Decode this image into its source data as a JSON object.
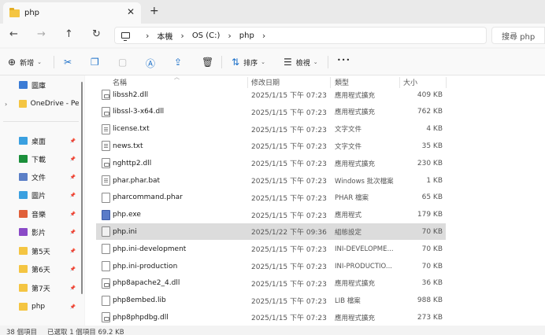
{
  "tab": {
    "title": "php",
    "close": "✕",
    "new_tab": "+"
  },
  "nav": {
    "back": "←",
    "forward": "→",
    "up": "↑",
    "refresh": "↻"
  },
  "address": {
    "segments": [
      "本機",
      "OS (C:)",
      "php"
    ]
  },
  "search": {
    "placeholder": "搜尋 php"
  },
  "commands": {
    "new_label": "新增",
    "sort_label": "排序",
    "view_label": "檢視",
    "more": "•••"
  },
  "sidebar": {
    "items": [
      {
        "label": "圖庫",
        "icon": "gallery-icon",
        "color": "#3a7bd5"
      },
      {
        "label": "OneDrive - Pers",
        "icon": "folder-icon",
        "color": "#f4c542"
      },
      {
        "label": "桌面",
        "icon": "desktop-icon",
        "color": "#3aa0e0"
      },
      {
        "label": "下載",
        "icon": "download-icon",
        "color": "#1a8f3a"
      },
      {
        "label": "文件",
        "icon": "documents-icon",
        "color": "#5b7fc7"
      },
      {
        "label": "圖片",
        "icon": "pictures-icon",
        "color": "#3aa0e0"
      },
      {
        "label": "音樂",
        "icon": "music-icon",
        "color": "#e0603a"
      },
      {
        "label": "影片",
        "icon": "videos-icon",
        "color": "#8a4ac7"
      },
      {
        "label": "第5天",
        "icon": "folder-icon",
        "color": "#f4c542"
      },
      {
        "label": "第6天",
        "icon": "folder-icon",
        "color": "#f4c542"
      },
      {
        "label": "第7天",
        "icon": "folder-icon",
        "color": "#f4c542"
      },
      {
        "label": "php",
        "icon": "folder-icon",
        "color": "#f4c542"
      }
    ]
  },
  "columns": {
    "name": "名稱",
    "date": "修改日期",
    "type": "類型",
    "size": "大小"
  },
  "files": [
    {
      "name": "libssh2.dll",
      "date": "2025/1/15 下午 07:23",
      "type": "應用程式擴充",
      "size": "409 KB",
      "icon": "dll"
    },
    {
      "name": "libssl-3-x64.dll",
      "date": "2025/1/15 下午 07:23",
      "type": "應用程式擴充",
      "size": "762 KB",
      "icon": "dll"
    },
    {
      "name": "license.txt",
      "date": "2025/1/15 下午 07:23",
      "type": "文字文件",
      "size": "4 KB",
      "icon": "txt"
    },
    {
      "name": "news.txt",
      "date": "2025/1/15 下午 07:23",
      "type": "文字文件",
      "size": "35 KB",
      "icon": "txt"
    },
    {
      "name": "nghttp2.dll",
      "date": "2025/1/15 下午 07:23",
      "type": "應用程式擴充",
      "size": "230 KB",
      "icon": "dll"
    },
    {
      "name": "phar.phar.bat",
      "date": "2025/1/15 下午 07:23",
      "type": "Windows 批次檔案",
      "size": "1 KB",
      "icon": "txt"
    },
    {
      "name": "pharcommand.phar",
      "date": "2025/1/15 下午 07:23",
      "type": "PHAR 檔案",
      "size": "65 KB",
      "icon": "file"
    },
    {
      "name": "php.exe",
      "date": "2025/1/15 下午 07:23",
      "type": "應用程式",
      "size": "179 KB",
      "icon": "exe"
    },
    {
      "name": "php.ini",
      "date": "2025/1/22 下午 09:36",
      "type": "組態設定",
      "size": "70 KB",
      "icon": "ini",
      "selected": true
    },
    {
      "name": "php.ini-development",
      "date": "2025/1/15 下午 07:23",
      "type": "INI-DEVELOPME...",
      "size": "70 KB",
      "icon": "file"
    },
    {
      "name": "php.ini-production",
      "date": "2025/1/15 下午 07:23",
      "type": "INI-PRODUCTIO...",
      "size": "70 KB",
      "icon": "file"
    },
    {
      "name": "php8apache2_4.dll",
      "date": "2025/1/15 下午 07:23",
      "type": "應用程式擴充",
      "size": "36 KB",
      "icon": "dll"
    },
    {
      "name": "php8embed.lib",
      "date": "2025/1/15 下午 07:23",
      "type": "LIB 檔案",
      "size": "988 KB",
      "icon": "file"
    },
    {
      "name": "php8phpdbg.dll",
      "date": "2025/1/15 下午 07:23",
      "type": "應用程式擴充",
      "size": "273 KB",
      "icon": "dll"
    }
  ],
  "status": {
    "count": "38 個項目",
    "selection": "已選取 1 個項目  69.2 KB"
  }
}
